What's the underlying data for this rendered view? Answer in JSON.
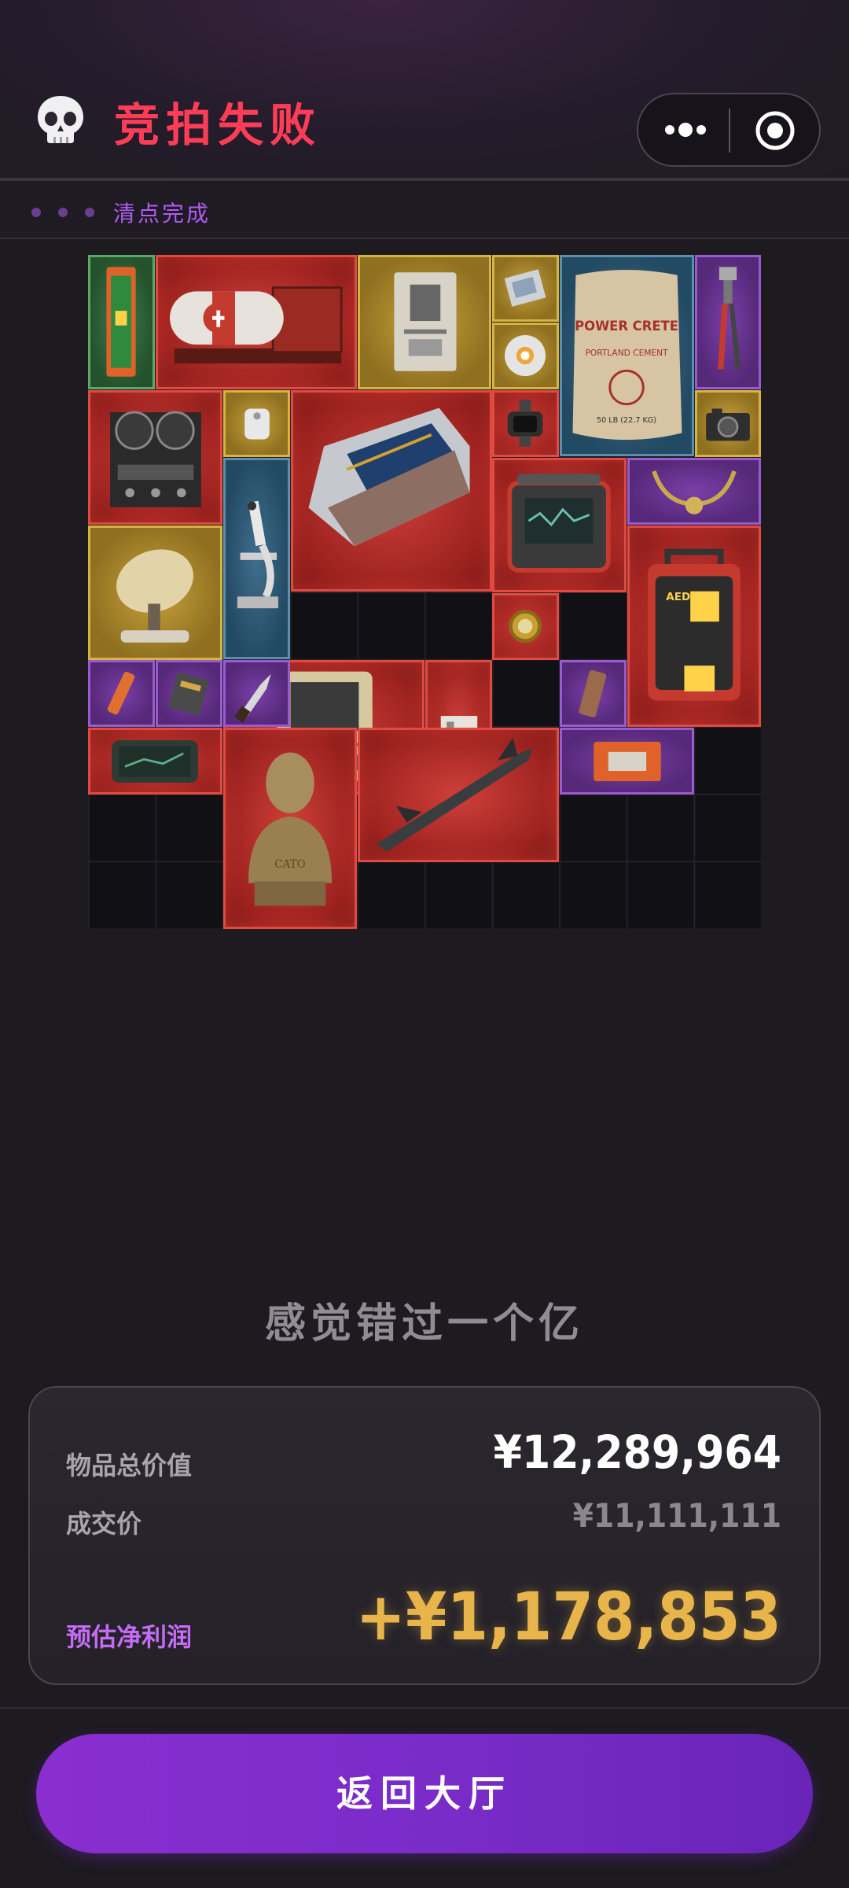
{
  "header": {
    "title": "竞拍失败",
    "skull_icon": "skull-icon",
    "capsule": {
      "more_icon": "more-dots-icon",
      "target_icon": "target-close-icon"
    },
    "colors": {
      "title": "#ff3d57",
      "accent": "#b25cf2"
    }
  },
  "status": {
    "text": "清点完成"
  },
  "items": [
    {
      "name": "fire-extinguisher-cabinet",
      "rarity": "green"
    },
    {
      "name": "aircraft-flight-recorder",
      "rarity": "red"
    },
    {
      "name": "id-card",
      "rarity": "yellow"
    },
    {
      "name": "cpu-chip",
      "rarity": "yellow"
    },
    {
      "name": "cement-bag",
      "rarity": "blue",
      "label_lines": [
        "POWER CRETE",
        "PORTLAND CEMENT",
        "50 LB (22.7 KG)"
      ]
    },
    {
      "name": "pipe-wrench",
      "rarity": "purple"
    },
    {
      "name": "robot-sphere",
      "rarity": "yellow"
    },
    {
      "name": "reel-to-reel-recorder",
      "rarity": "red"
    },
    {
      "name": "access-tag",
      "rarity": "yellow"
    },
    {
      "name": "server-rack-module",
      "rarity": "red"
    },
    {
      "name": "smart-watch",
      "rarity": "red"
    },
    {
      "name": "camera",
      "rarity": "yellow"
    },
    {
      "name": "microscope",
      "rarity": "blue"
    },
    {
      "name": "field-monitor-device",
      "rarity": "red"
    },
    {
      "name": "horn-necklace",
      "rarity": "purple"
    },
    {
      "name": "satellite-dish",
      "rarity": "yellow"
    },
    {
      "name": "aed-defibrillator",
      "rarity": "red",
      "label": "AED"
    },
    {
      "name": "rugged-laptop-case",
      "rarity": "red"
    },
    {
      "name": "memory-card",
      "rarity": "red"
    },
    {
      "name": "gold-watch",
      "rarity": "red"
    },
    {
      "name": "flashlight",
      "rarity": "purple"
    },
    {
      "name": "circuit-board",
      "rarity": "purple"
    },
    {
      "name": "knife",
      "rarity": "purple"
    },
    {
      "name": "energy-bar",
      "rarity": "purple"
    },
    {
      "name": "tablet-device",
      "rarity": "red"
    },
    {
      "name": "bronze-bust",
      "rarity": "red",
      "label": "CATO"
    },
    {
      "name": "missile",
      "rarity": "red"
    },
    {
      "name": "medkit-box",
      "rarity": "purple"
    }
  ],
  "result": {
    "quote": "感觉错过一个亿",
    "total_label": "物品总价值",
    "total_value": "¥12,289,964",
    "deal_label": "成交价",
    "deal_value": "¥11,111,111",
    "profit_label": "预估净利润",
    "profit_value": "+¥1,178,853",
    "profit_color": "#e8b54a"
  },
  "actions": {
    "back_label": "返回大厅"
  }
}
